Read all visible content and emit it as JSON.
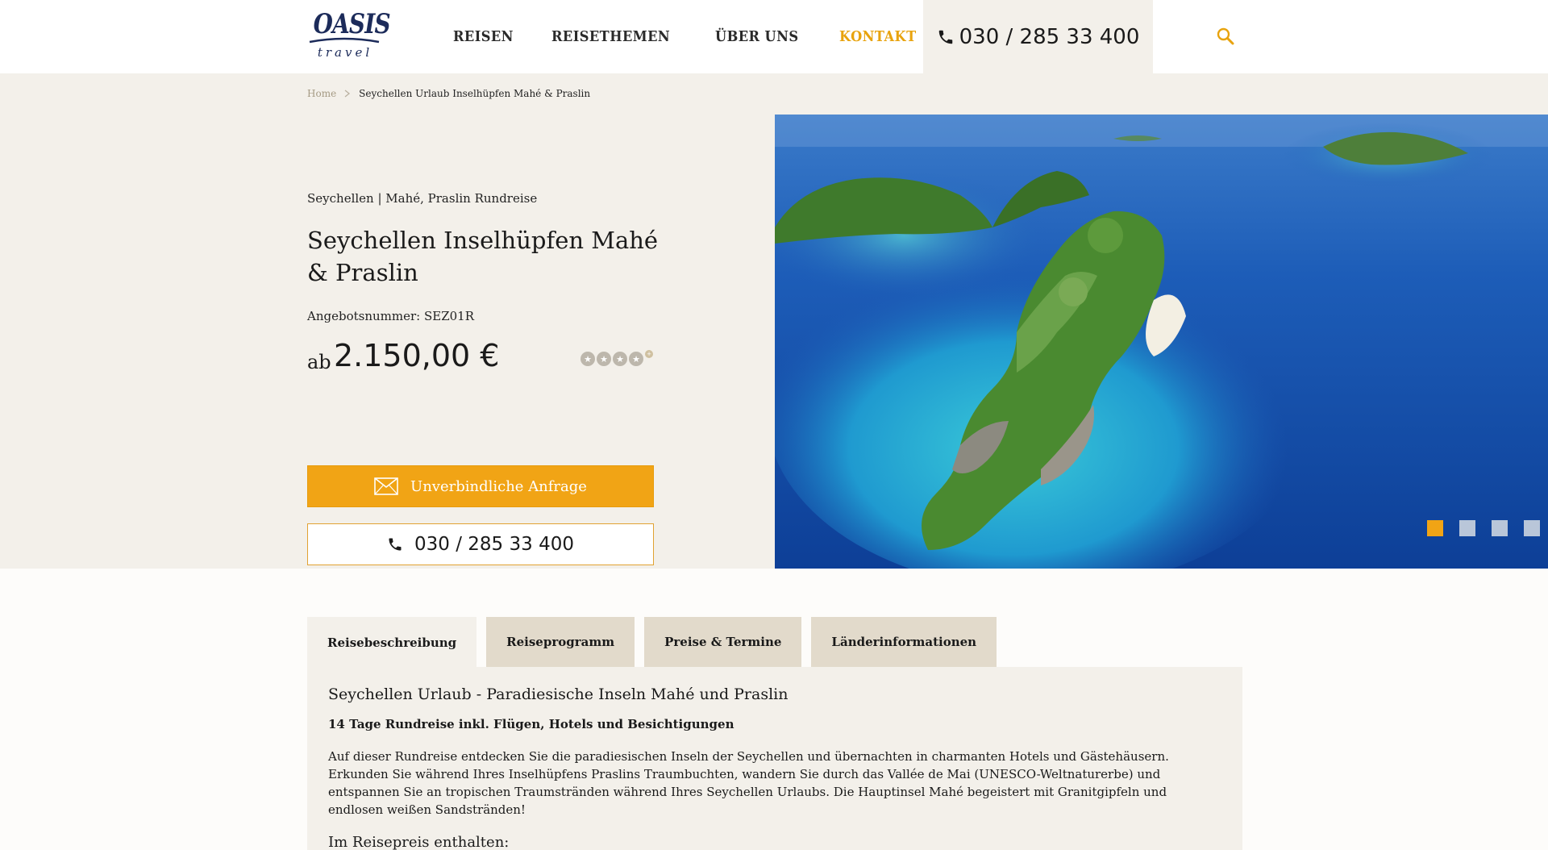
{
  "header": {
    "logo": {
      "main": "OASIS",
      "sub": "travel"
    },
    "nav": [
      "REISEN",
      "REISETHEMEN",
      "ÜBER UNS",
      "KONTAKT"
    ],
    "nav_active_index": 3,
    "phone": "030 / 285 33 400",
    "icons": {
      "phone": "phone-icon",
      "search": "search-icon"
    }
  },
  "breadcrumb": {
    "home": "Home",
    "current": "Seychellen Urlaub Inselhüpfen Mahé & Praslin"
  },
  "trip": {
    "subtitle": "Seychellen | Mahé, Praslin Rundreise",
    "title": "Seychellen Inselhüpfen Mahé & Praslin",
    "offer_number": "Angebotsnummer: SEZ01R",
    "price_prefix": "ab",
    "price": "2.150,00 €",
    "rating_stars": 4,
    "rating_extra": "+",
    "inquiry_button": "Unverbindliche Anfrage",
    "phone_button": "030 / 285 33 400"
  },
  "gallery": {
    "slides": 4,
    "active_slide": 0
  },
  "tabs": [
    "Reisebeschreibung",
    "Reiseprogramm",
    "Preise & Termine",
    "Länderinformationen"
  ],
  "active_tab": 0,
  "content": {
    "heading": "Seychellen Urlaub - Paradiesische Inseln Mahé und Praslin",
    "bold_line": "14 Tage Rundreise inkl. Flügen, Hotels und Besichtigungen",
    "paragraph": "Auf dieser Rundreise entdecken Sie die paradiesischen Inseln der Seychellen und übernachten in charmanten Hotels und Gästehäusern. Erkunden Sie während Ihres Inselhüpfens Praslins Traumbuchten, wandern Sie durch das Vallée de Mai (UNESCO-Weltnaturerbe) und entspannen Sie an tropischen Traumstränden während Ihres Seychellen Urlaubs. Die Hauptinsel Mahé begeistert mit Granitgipfeln und endlosen weißen Sandstränden!",
    "included_heading": "Im Reisepreis enthalten:"
  },
  "colors": {
    "accent": "#f1a415",
    "navy": "#1c2b5a",
    "beige_bg": "#f3f0ea",
    "tab_bg": "#e2dacb"
  }
}
